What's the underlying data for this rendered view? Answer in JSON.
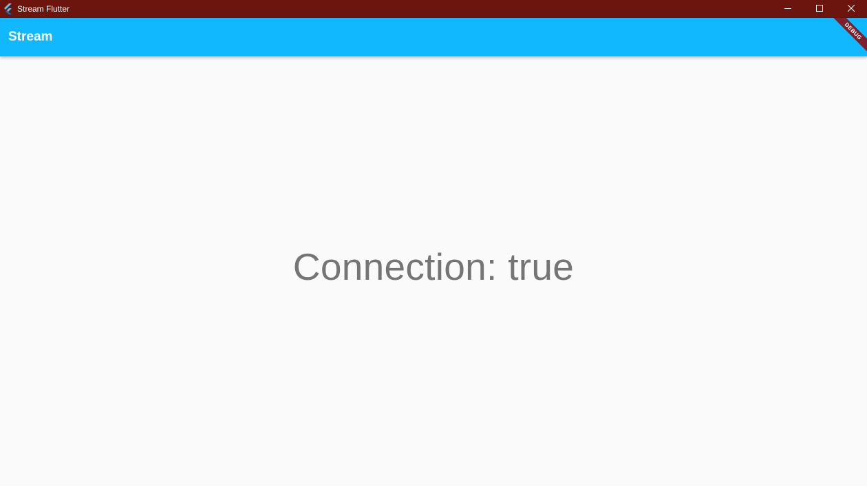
{
  "window": {
    "title": "Stream Flutter",
    "icon": "flutter-logo-icon",
    "controls": [
      "minimize-icon",
      "maximize-icon",
      "close-icon"
    ]
  },
  "appbar": {
    "title": "Stream"
  },
  "debug_banner": {
    "label": "DEBUG"
  },
  "main": {
    "status_text": "Connection: true"
  },
  "colors": {
    "titlebar": "#6b150e",
    "appbar": "#12b8fd",
    "background": "#fafafa",
    "status_text": "#757575",
    "debug_ribbon": "#7a1f2b"
  }
}
